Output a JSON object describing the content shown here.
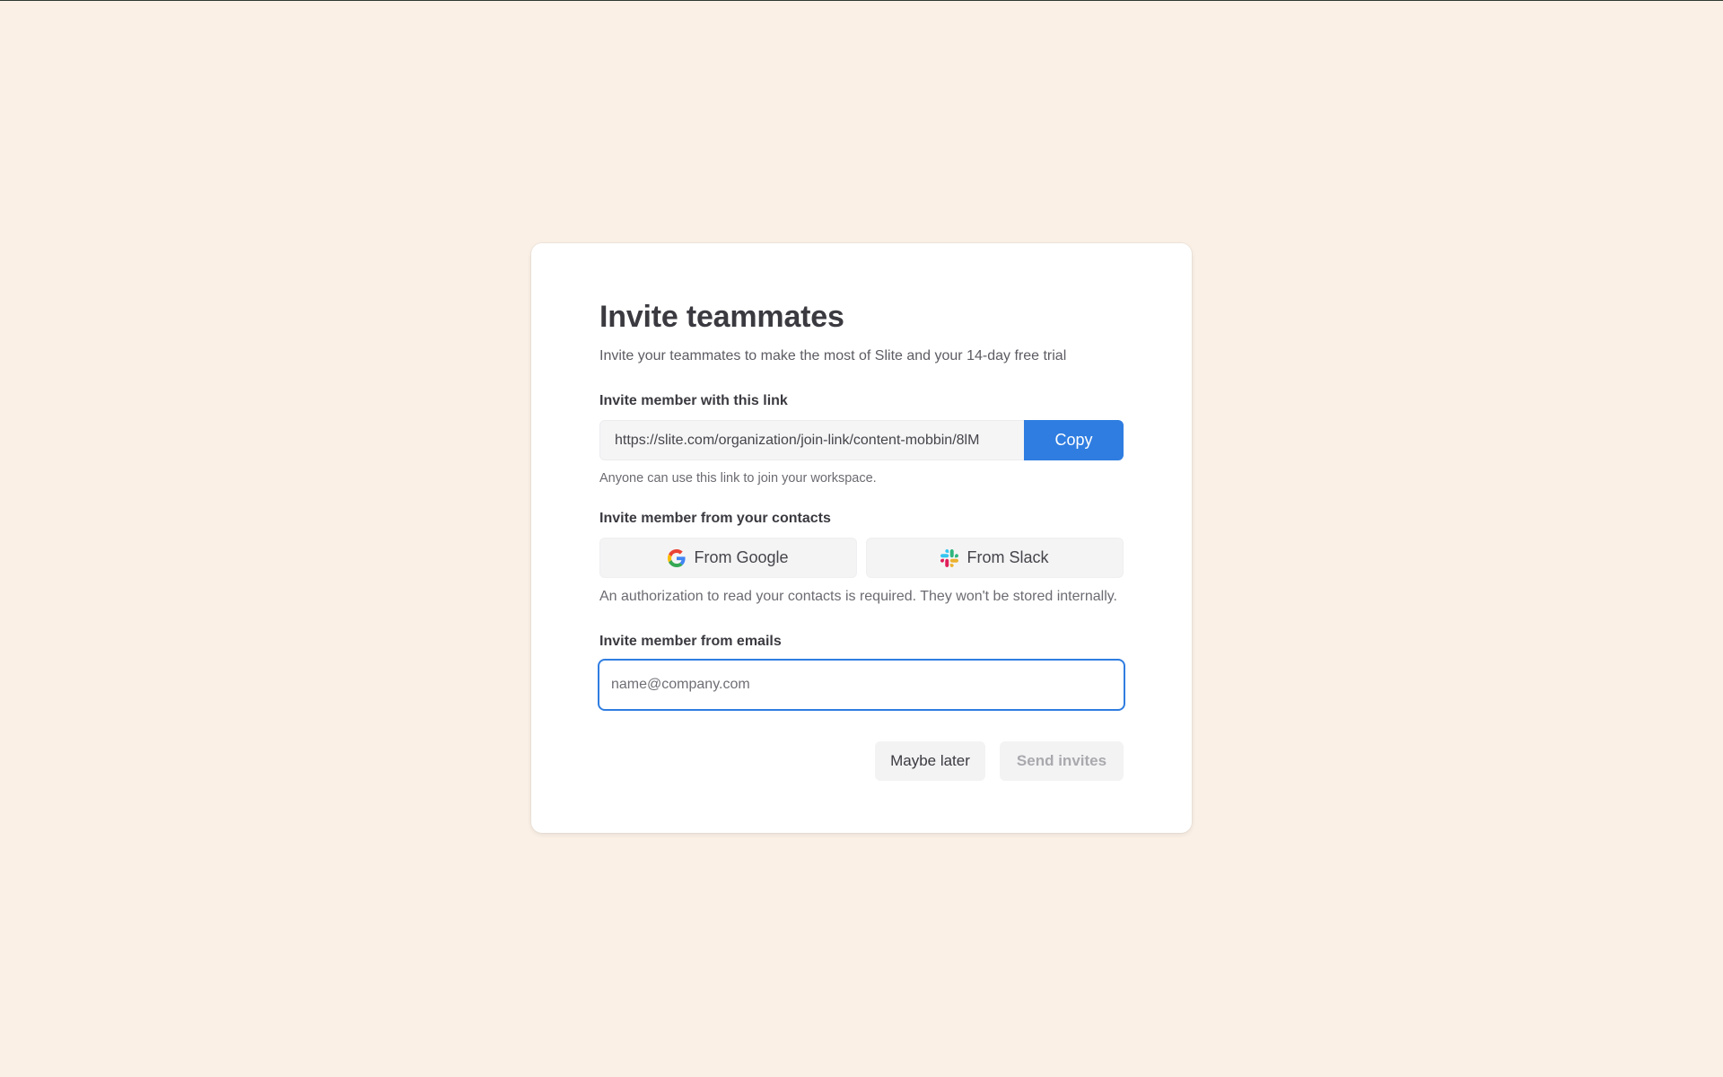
{
  "modal": {
    "title": "Invite teammates",
    "subtitle": "Invite your teammates to make the most of Slite and your 14-day free trial"
  },
  "link_section": {
    "label": "Invite member with this link",
    "url": "https://slite.com/organization/join-link/content-mobbin/8lM",
    "copy_label": "Copy",
    "helper": "Anyone can use this link to join your workspace."
  },
  "contacts_section": {
    "label": "Invite member from your contacts",
    "google_label": "From Google",
    "google_icon": "google-icon",
    "slack_label": "From Slack",
    "slack_icon": "slack-icon",
    "helper": "An authorization to read your contacts is required. They won't be stored internally."
  },
  "emails_section": {
    "label": "Invite member from emails",
    "placeholder": "name@company.com",
    "value": ""
  },
  "actions": {
    "later_label": "Maybe later",
    "send_label": "Send invites",
    "send_disabled": true
  },
  "colors": {
    "background": "#faf0e6",
    "accent": "#2f7de1",
    "card": "#ffffff"
  }
}
